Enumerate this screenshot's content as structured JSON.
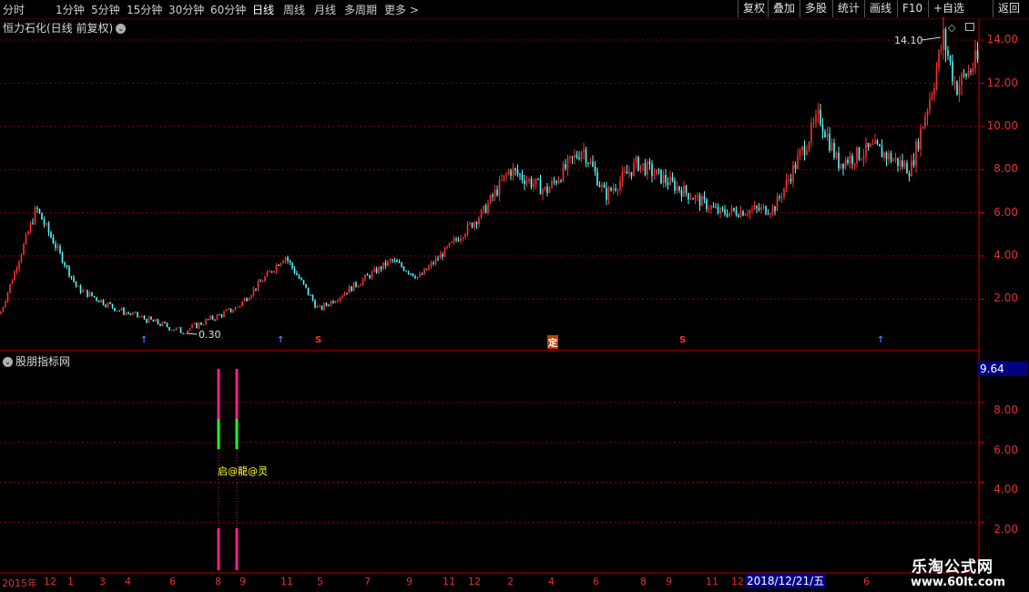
{
  "toolbar": {
    "periods": [
      "分时",
      "1分钟",
      "5分钟",
      "15分钟",
      "30分钟",
      "60分钟",
      "日线",
      "周线",
      "月线",
      "多周期",
      "更多 >"
    ],
    "active_period": "日线",
    "right_buttons": [
      "复权",
      "叠加",
      "多股",
      "统计",
      "画线",
      "F10",
      "+自选",
      "返回"
    ]
  },
  "main": {
    "title": "恒力石化(日线 前复权)",
    "price_ticks": [
      "14.00",
      "12.00",
      "10.00",
      "8.00",
      "6.00",
      "4.00",
      "2.00"
    ],
    "high_label": "14.10",
    "low_label": "0.30",
    "markers": [
      "↑",
      "↑",
      "S",
      "定",
      "S",
      "↑"
    ]
  },
  "sub": {
    "title": "股朋指标网",
    "current_value": "9.64",
    "ticks": [
      "8.00",
      "6.00",
      "4.00",
      "2.00"
    ],
    "signal_text": "启@龍@灵"
  },
  "xaxis": {
    "labels": [
      "2015年",
      "12",
      "1",
      "3",
      "4",
      "6",
      "8",
      "9",
      "11",
      "5",
      "7",
      "9",
      "11",
      "12",
      "2",
      "4",
      "6",
      "8",
      "9",
      "11",
      "12",
      "4",
      "6"
    ],
    "cursor_date": "2018/12/21/五"
  },
  "watermark": {
    "line1": "乐淘公式网",
    "line2": "www.60lt.com"
  },
  "colors": {
    "up": "#ff3030",
    "down": "#54fcfc",
    "grid": "#8b0000",
    "axis": "#c00000",
    "bar_magenta": "#ff1e8c",
    "bar_green": "#1eff1e"
  },
  "chart_data": {
    "type": "candlestick",
    "y_range": [
      0.3,
      14.1
    ],
    "points": [
      {
        "date": "2015",
        "close": 1.3
      },
      {
        "date": "2015-06",
        "close": 6.2
      },
      {
        "date": "2015-07",
        "close": 2.5
      },
      {
        "date": "2016-01",
        "close": 1.5
      },
      {
        "date": "2016-05",
        "close": 0.5
      },
      {
        "date": "2016-09",
        "close": 1.6
      },
      {
        "date": "2016-11",
        "close": 4.0
      },
      {
        "date": "2016-12",
        "close": 1.5
      },
      {
        "date": "2017-03",
        "close": 3.8
      },
      {
        "date": "2017-06",
        "close": 3.0
      },
      {
        "date": "2017-09",
        "close": 6.0
      },
      {
        "date": "2017-11",
        "close": 8.0
      },
      {
        "date": "2018-01",
        "close": 7.0
      },
      {
        "date": "2018-02",
        "close": 9.0
      },
      {
        "date": "2018-04",
        "close": 6.8
      },
      {
        "date": "2018-06",
        "close": 8.3
      },
      {
        "date": "2018-09",
        "close": 6.0
      },
      {
        "date": "2018-12",
        "close": 6.2
      },
      {
        "date": "2019-01",
        "close": 10.5
      },
      {
        "date": "2019-03",
        "close": 8.3
      },
      {
        "date": "2019-05",
        "close": 9.0
      },
      {
        "date": "2019-06",
        "close": 8.0
      },
      {
        "date": "2019-07",
        "close": 12.0
      },
      {
        "date": "2019-08",
        "close": 14.1
      },
      {
        "date": "2019-09",
        "close": 11.8
      },
      {
        "date": "2019-10",
        "close": 13.0
      }
    ]
  }
}
